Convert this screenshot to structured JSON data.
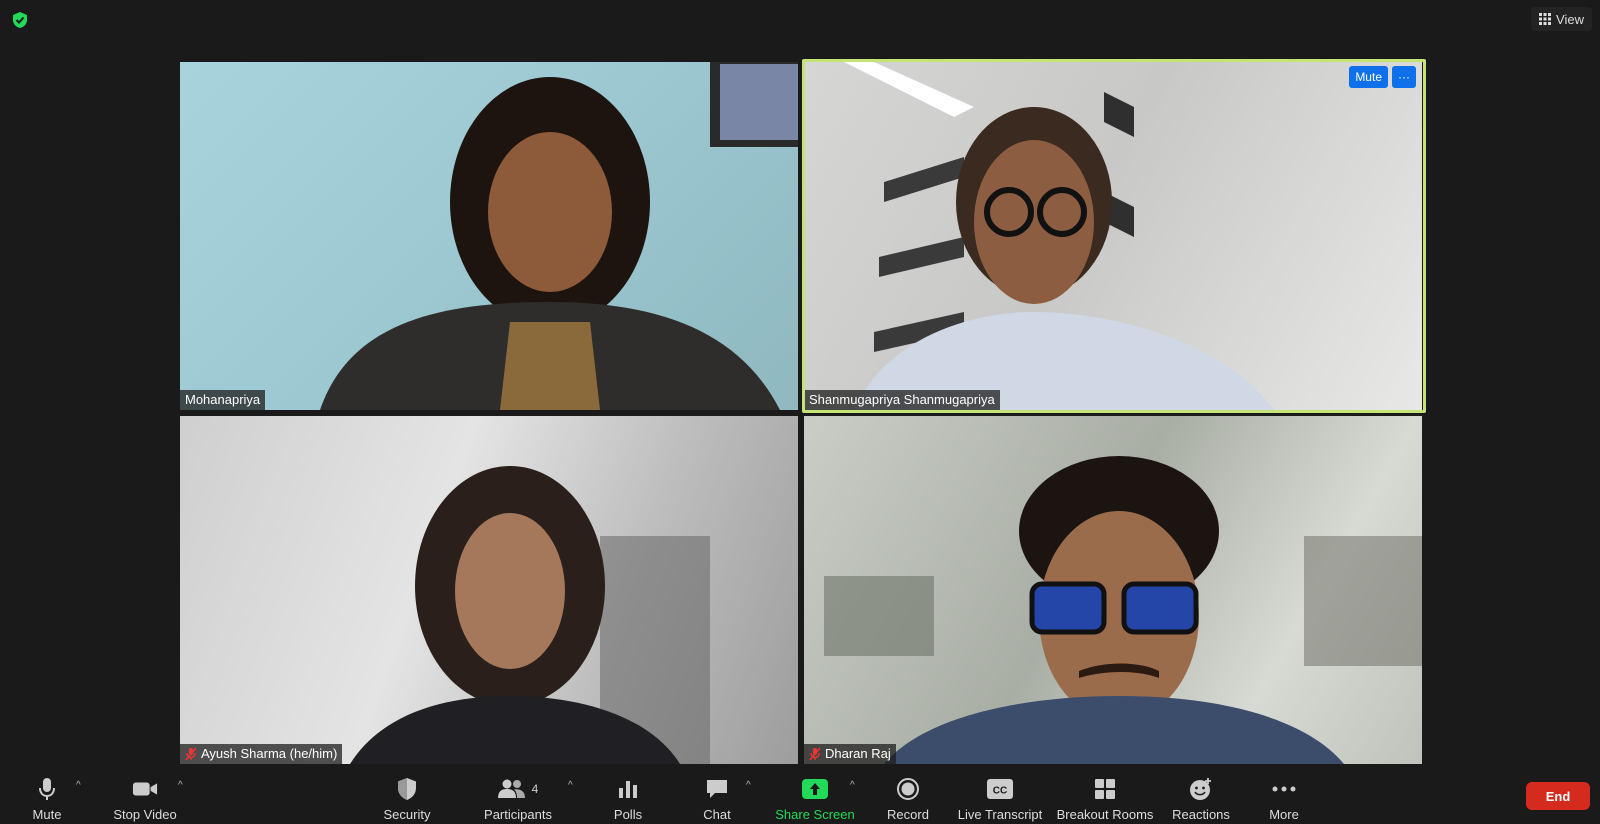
{
  "top": {
    "view_label": "View"
  },
  "participants": [
    {
      "name": "Mohanapriya",
      "muted": false
    },
    {
      "name": "Shanmugapriya Shanmugapriya",
      "muted": false,
      "active": true
    },
    {
      "name": "Ayush Sharma (he/him)",
      "muted": true
    },
    {
      "name": "Dharan Raj",
      "muted": true
    }
  ],
  "tile_controls": {
    "mute_label": "Mute",
    "more_label": "···"
  },
  "toolbar": {
    "mute": "Mute",
    "stop_video": "Stop Video",
    "security": "Security",
    "participants": "Participants",
    "participants_count": "4",
    "polls": "Polls",
    "chat": "Chat",
    "share_screen": "Share Screen",
    "record": "Record",
    "live_transcript": "Live Transcript",
    "breakout_rooms": "Breakout Rooms",
    "reactions": "Reactions",
    "more": "More",
    "end": "End"
  },
  "colors": {
    "active_speaker": "#c6e377",
    "accent": "#0e71eb",
    "share": "#23d959",
    "end": "#d52b1e"
  }
}
